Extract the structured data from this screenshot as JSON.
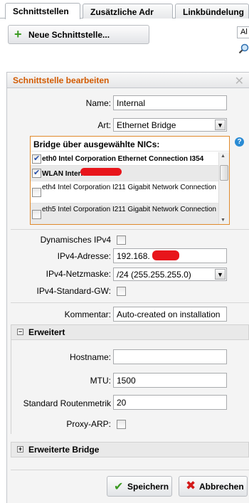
{
  "tabs": [
    {
      "label": "Schnittstellen"
    },
    {
      "label": "Zusätzliche Adr"
    },
    {
      "label": "Linkbündelung"
    }
  ],
  "toolbar": {
    "new_interface_label": "Neue Schnittstelle...",
    "right_stub_text": "Al"
  },
  "dialog": {
    "title": "Schnittstelle bearbeiten",
    "name_label": "Name:",
    "name_value": "Internal",
    "type_label": "Art:",
    "type_value": "Ethernet Bridge",
    "nic_header": "Bridge über ausgewählte NICs:",
    "nics": [
      {
        "text": "eth0 Intel Corporation Ethernet Connection I354",
        "checked": true
      },
      {
        "text": "WLAN Intern",
        "checked": true
      },
      {
        "text": "eth4 Intel Corporation I211 Gigabit Network Connection",
        "checked": false
      },
      {
        "text": "eth5 Intel Corporation I211 Gigabit Network Connection",
        "checked": false
      }
    ],
    "dyn_ipv4_label": "Dynamisches IPv4",
    "ipv4_address_label": "IPv4-Adresse:",
    "ipv4_address_value": "192.168.",
    "ipv4_netmask_label": "IPv4-Netzmaske:",
    "ipv4_netmask_value": "/24 (255.255.255.0)",
    "ipv4_gw_label": "IPv4-Standard-GW:",
    "comment_label": "Kommentar:",
    "comment_value": "Auto-created on installation",
    "advanced_title": "Erweitert",
    "hostname_label": "Hostname:",
    "hostname_value": "",
    "mtu_label": "MTU:",
    "mtu_value": "1500",
    "route_metric_label": "Standard Routenmetrik",
    "route_metric_value": "20",
    "proxy_arp_label": "Proxy-ARP:",
    "advanced_bridge_title": "Erweiterte Bridge",
    "save_label": "Speichern",
    "cancel_label": "Abbrechen"
  },
  "colors": {
    "accent": "#d25a00",
    "ok": "#3b9a22",
    "cancel": "#d31a1a",
    "redaction": "#e8151b"
  }
}
